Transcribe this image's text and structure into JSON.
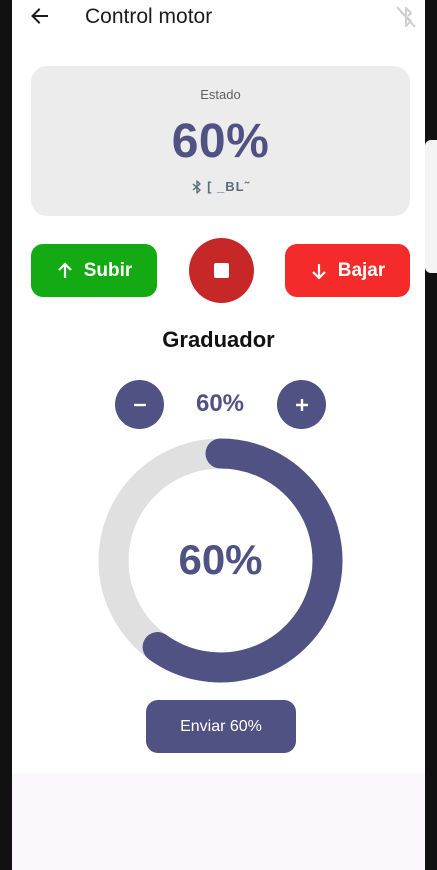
{
  "app_bar": {
    "title": "Control motor",
    "back_icon": "arrow-left-icon",
    "bluetooth_icon": "bluetooth-disabled-icon"
  },
  "status_card": {
    "label": "Estado",
    "value": "60%",
    "device_name": "[ _BL˜",
    "device_icon": "bluetooth-icon"
  },
  "controls": {
    "up_label": "Subir",
    "down_label": "Bajar",
    "up_icon": "arrow-up-icon",
    "down_icon": "arrow-down-icon",
    "stop_icon": "stop-icon"
  },
  "graduator": {
    "title": "Graduador",
    "stepper_value": "60%",
    "gauge_value": "60%",
    "level": 0.6,
    "send_label": "Enviar 60%"
  },
  "colors": {
    "accent": "#4f5282",
    "up": "#13aa13",
    "stop": "#c62828",
    "down": "#f52a2a",
    "track": "#e0e0e0"
  }
}
